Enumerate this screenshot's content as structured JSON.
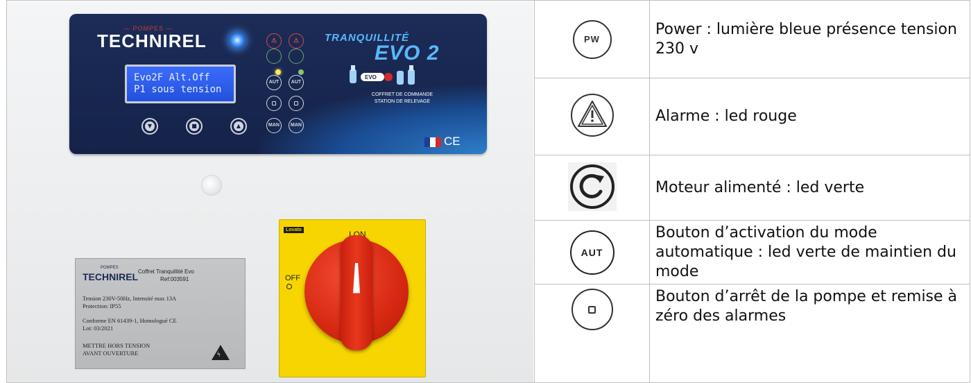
{
  "photo": {
    "brand_small": "— POMPES —",
    "brand": "TECHNIREL",
    "lcd_line1": "Evo2F Alt.Off",
    "lcd_line2": "P1 sous tension",
    "btn_aut": "AUT",
    "btn_man": "MAN",
    "product_line1": "TRANQUILLITÉ",
    "product_line2": "EVO 2",
    "product_badge": "EVO",
    "product_sub1": "COFFRET DE COMMANDE",
    "product_sub2": "STATION DE RELEVAGE",
    "ce_mark": "CE",
    "flag_colors": [
      "#1a3d9c",
      "#ffffff",
      "#d42a2a"
    ],
    "switch_brand": "Lovato",
    "switch_on": "I ON",
    "switch_off": "OFF",
    "plate": {
      "brand_small": "POMPES",
      "brand": "TECHNIREL",
      "title": "Coffret Tranquillité Evo",
      "ref": "Ref:003591",
      "line1": "Tension 230V-50Hz, Intensité max 13A",
      "line2": "Protection: IP55",
      "line3": "Conforme EN 61439-1, Homologué CE",
      "line4": "Lot: 03/2021",
      "line5": "METTRE HORS TENSION",
      "line6": "AVANT OUVERTURE"
    }
  },
  "rows": [
    {
      "icon": "power-icon",
      "icon_text": "PW",
      "description": "Power : lumière bleue présence tension 230 v"
    },
    {
      "icon": "alarm-warning-icon",
      "description": "Alarme : led rouge"
    },
    {
      "icon": "motor-rotation-icon",
      "description": "Moteur alimenté : led verte"
    },
    {
      "icon": "auto-mode-icon",
      "icon_text": "AUT",
      "description": "Bouton d’activation du mode automatique : led verte de maintien du mode"
    },
    {
      "icon": "stop-button-icon",
      "description": "Bouton d’arrêt de la pompe et remise à zéro des alarmes"
    }
  ],
  "colors": {
    "panel_navy": "#15234a",
    "lcd_blue": "#2250dd",
    "power_led": "#58a8ff",
    "alarm_red": "#d54848",
    "switch_yellow": "#f6d500",
    "switch_red": "#d62811"
  }
}
